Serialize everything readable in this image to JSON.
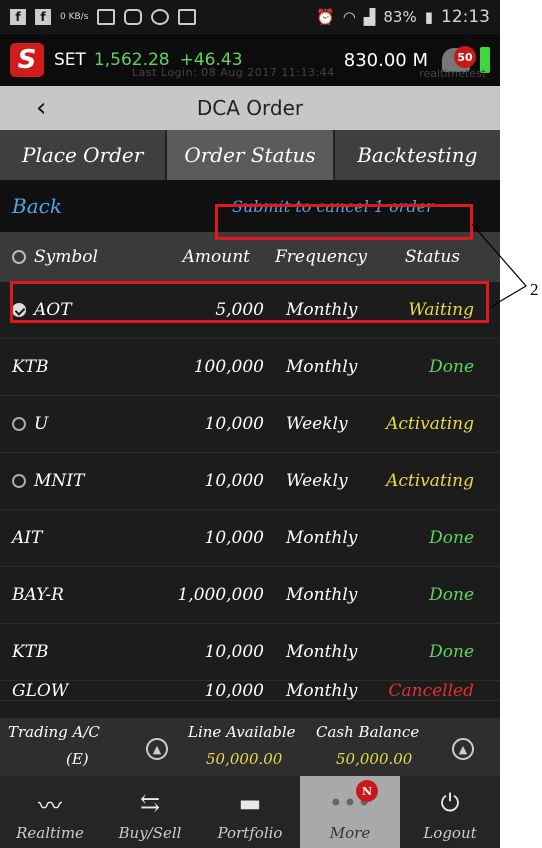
{
  "statusbar": {
    "net_speed": "0 KB/s",
    "battery_pct": "83%",
    "time": "12:13"
  },
  "ticker": {
    "market": "SET",
    "index": "1,562.28",
    "change": "+46.43",
    "value": "830.00 M",
    "last_login": "Last Login: 08 Aug 2017 11:13:44",
    "user": "realtimetest",
    "notif_count": "50"
  },
  "titlebar": {
    "title": "DCA Order"
  },
  "tabs": [
    "Place Order",
    "Order Status",
    "Backtesting"
  ],
  "actions": {
    "back": "Back",
    "submit": "Submit to cancel 1 order"
  },
  "table": {
    "headers": {
      "symbol": "Symbol",
      "amount": "Amount",
      "frequency": "Frequency",
      "status": "Status"
    },
    "rows": [
      {
        "symbol": "AOT",
        "amount": "5,000",
        "frequency": "Monthly",
        "status": "Waiting",
        "radio": "checked",
        "status_color": "#e8d84a"
      },
      {
        "symbol": "KTB",
        "amount": "100,000",
        "frequency": "Monthly",
        "status": "Done",
        "radio": "none",
        "status_color": "#5fd35f"
      },
      {
        "symbol": "U",
        "amount": "10,000",
        "frequency": "Weekly",
        "status": "Activating",
        "radio": "empty",
        "status_color": "#e8d84a"
      },
      {
        "symbol": "MNIT",
        "amount": "10,000",
        "frequency": "Weekly",
        "status": "Activating",
        "radio": "empty",
        "status_color": "#e8d84a"
      },
      {
        "symbol": "AIT",
        "amount": "10,000",
        "frequency": "Monthly",
        "status": "Done",
        "radio": "none",
        "status_color": "#5fd35f"
      },
      {
        "symbol": "BAY-R",
        "amount": "1,000,000",
        "frequency": "Monthly",
        "status": "Done",
        "radio": "none",
        "status_color": "#5fd35f"
      },
      {
        "symbol": "KTB",
        "amount": "10,000",
        "frequency": "Monthly",
        "status": "Done",
        "radio": "none",
        "status_color": "#5fd35f"
      },
      {
        "symbol": "GLOW",
        "amount": "10,000",
        "frequency": "Monthly",
        "status": "Cancelled",
        "radio": "none",
        "status_color": "#e03030"
      }
    ]
  },
  "footer": {
    "trading_ac_label": "Trading A/C",
    "trading_ac_value": "(E)",
    "line_available_label": "Line Available",
    "line_available_value": "50,000.00",
    "cash_balance_label": "Cash Balance",
    "cash_balance_value": "50,000.00"
  },
  "nav": [
    {
      "label": "Realtime",
      "icon": "chart-line-icon"
    },
    {
      "label": "Buy/Sell",
      "icon": "buy-sell-arrows-icon"
    },
    {
      "label": "Portfolio",
      "icon": "folder-icon"
    },
    {
      "label": "More",
      "icon": "more-dots-icon",
      "badge": "N",
      "active": true
    },
    {
      "label": "Logout",
      "icon": "power-icon"
    }
  ],
  "annotation": {
    "number": "2"
  },
  "colors": {
    "highlight": "#e0181c",
    "link": "#4ea6e6",
    "positive": "#5fd35f",
    "pending": "#e8d84a"
  }
}
